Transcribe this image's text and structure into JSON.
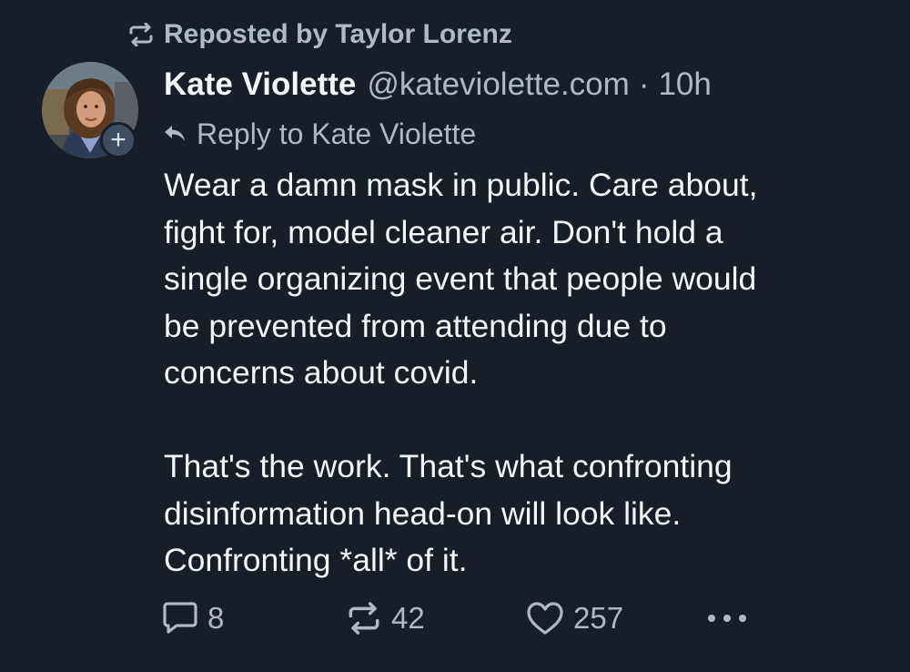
{
  "repost_banner": {
    "text": "Reposted by Taylor Lorenz",
    "icon": "repost-icon"
  },
  "author": {
    "display_name": "Kate Violette",
    "handle": "@kateviolette.com",
    "separator": "·",
    "time": "10h",
    "follow_icon": "plus-icon",
    "follow_symbol": "+"
  },
  "reply_context": {
    "text": "Reply to Kate Violette",
    "icon": "reply-arrow-icon"
  },
  "post": {
    "text": "Wear a damn mask in public. Care about,\nfight for, model cleaner air. Don't hold a\nsingle organizing event that people would\nbe prevented from attending due to\nconcerns about covid.\n\nThat's the work. That's what confronting\ndisinformation head-on will look like.\nConfronting *all* of it."
  },
  "actions": {
    "replies": "8",
    "reposts": "42",
    "likes": "257",
    "icons": [
      "comment-icon",
      "repost-icon",
      "heart-icon",
      "more-icon"
    ]
  },
  "colors": {
    "background": "#171e28",
    "primary_text": "#f4f6f8",
    "secondary_text": "#aeb9c6",
    "badge": "#3d4d62"
  }
}
